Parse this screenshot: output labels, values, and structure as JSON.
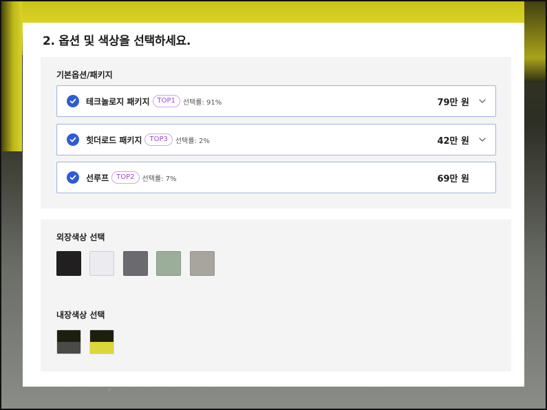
{
  "heading": "2. 옵션 및 색상을 선택하세요.",
  "options_section": {
    "title": "기본옵션/패키지",
    "items": [
      {
        "name": "테크놀로지 패키지",
        "badge": "TOP1",
        "rate": "선택률: 91%",
        "price": "79만 원",
        "expandable": true,
        "checked": true
      },
      {
        "name": "힛더로드 패키지",
        "badge": "TOP3",
        "rate": "선택률: 2%",
        "price": "42만 원",
        "expandable": true,
        "checked": true
      },
      {
        "name": "선루프",
        "badge": "TOP2",
        "rate": "선택률: 7%",
        "price": "69만 원",
        "expandable": false,
        "checked": true
      }
    ]
  },
  "exterior": {
    "title": "외장색상 선택",
    "swatches": [
      "#221f20",
      "#ebebf0",
      "#6b6a6e",
      "#9aae9a",
      "#a8a59f"
    ]
  },
  "interior": {
    "title": "내장색상 선택",
    "swatches": [
      {
        "top": "#1e1e0f",
        "bottom": "#4a4a47"
      },
      {
        "top": "#1e1e0f",
        "bottom": "#ddd63a"
      }
    ]
  },
  "colors": {
    "check_blue": "#2f5bd4",
    "badge_purple": "#9a49c9",
    "option_border": "#9fb3db",
    "section_bg": "#f4f4f4"
  },
  "icons": {
    "check": "check-icon",
    "chevron": "chevron-down-icon"
  }
}
